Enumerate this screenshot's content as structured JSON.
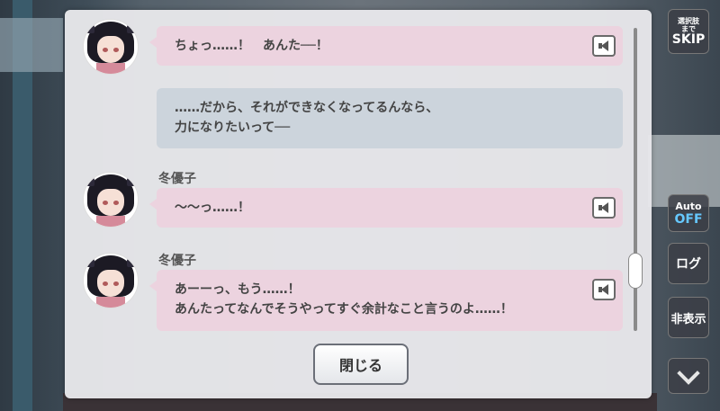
{
  "log": {
    "entries": [
      {
        "speaker": "",
        "text": "ちょっ……！　あんた──！",
        "style": "pink",
        "has_voice": true
      },
      {
        "speaker": "",
        "text_lines": [
          "……だから、それができなくなってるんなら、",
          "力になりたいって──"
        ],
        "style": "gray",
        "has_voice": false
      },
      {
        "speaker": "冬優子",
        "text": "～～っ……！",
        "style": "pink",
        "has_voice": true
      },
      {
        "speaker": "冬優子",
        "text_lines": [
          "あーーっ、もう……！",
          "あんたってなんでそうやってすぐ余計なこと言うのよ……！"
        ],
        "style": "pink",
        "has_voice": true
      }
    ],
    "close_label": "閉じる"
  },
  "side_menu": {
    "skip_small_1": "選択肢",
    "skip_small_2": "まで",
    "skip_big": "SKIP",
    "auto_label": "Auto",
    "auto_state": "OFF",
    "log_label": "ログ",
    "hide_label": "非表示"
  },
  "colors": {
    "bubble_pink": "#ecd3df",
    "bubble_gray": "#ccd4dc",
    "auto_off": "#66c8ff"
  },
  "icons": [
    "speaker-icon",
    "chevron-down-icon"
  ]
}
